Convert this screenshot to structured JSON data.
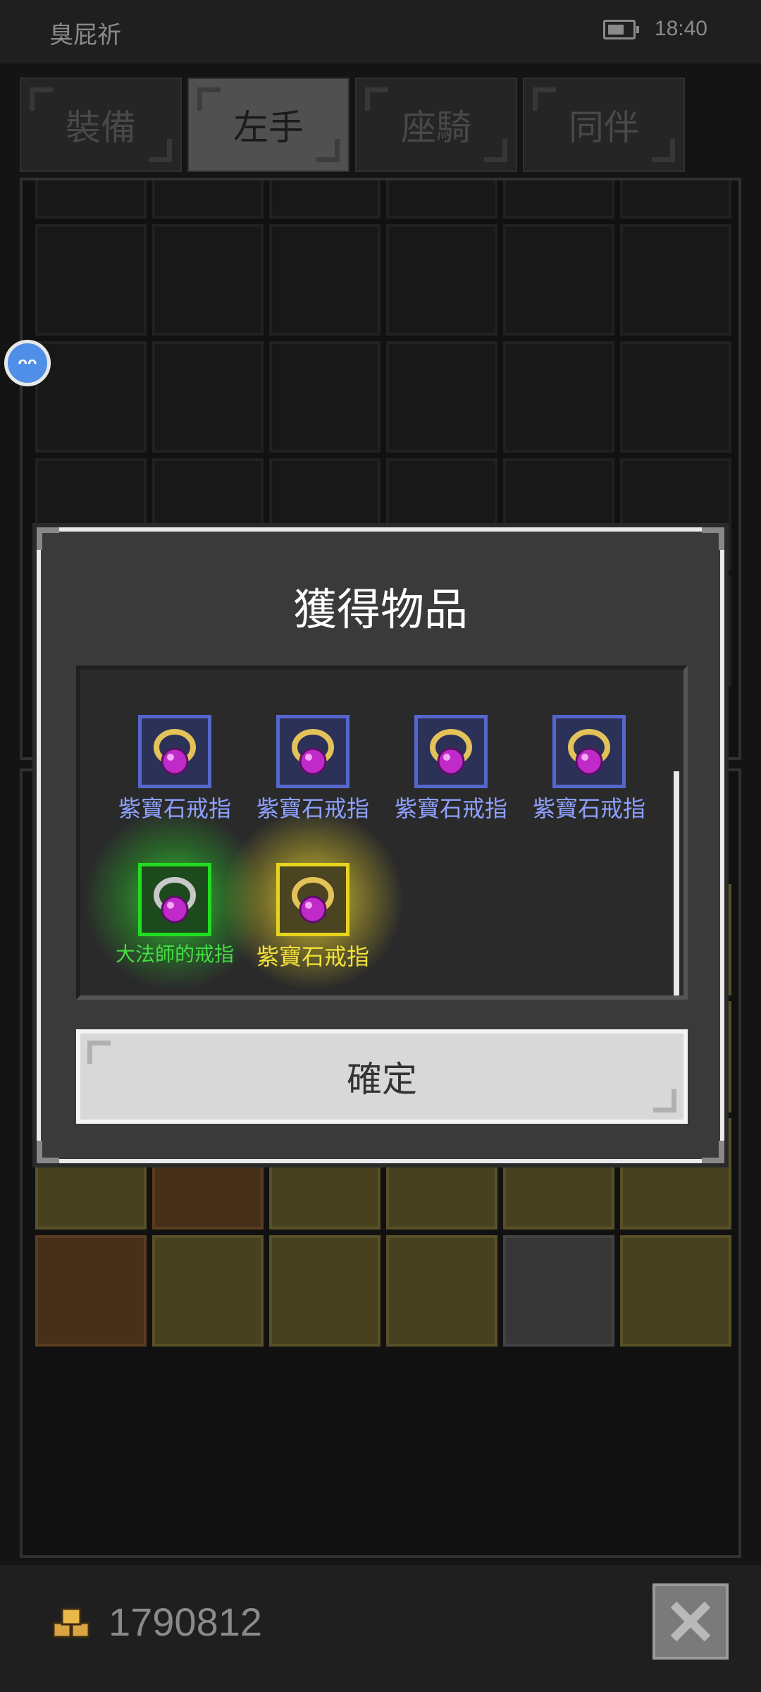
{
  "status_bar": {
    "carrier": "臭屁祈",
    "time": "18:40"
  },
  "tabs": [
    {
      "label": "裝備",
      "active": false
    },
    {
      "label": "左手",
      "active": true
    },
    {
      "label": "座騎",
      "active": false
    },
    {
      "label": "同伴",
      "active": false
    }
  ],
  "dialog": {
    "title": "獲得物品",
    "items": [
      {
        "name": "紫寶石戒指",
        "rarity": "blue",
        "icon": "amethyst-ring-icon"
      },
      {
        "name": "紫寶石戒指",
        "rarity": "blue",
        "icon": "amethyst-ring-icon"
      },
      {
        "name": "紫寶石戒指",
        "rarity": "blue",
        "icon": "amethyst-ring-icon"
      },
      {
        "name": "紫寶石戒指",
        "rarity": "blue",
        "icon": "amethyst-ring-icon"
      },
      {
        "name": "大法師的戒指",
        "rarity": "green",
        "icon": "silver-amethyst-ring-icon"
      },
      {
        "name": "紫寶石戒指",
        "rarity": "yellow",
        "icon": "amethyst-ring-icon"
      }
    ],
    "confirm_label": "確定"
  },
  "bottom": {
    "gold": "1790812"
  },
  "colors": {
    "rare_blue": "#8fa0ff",
    "rare_green": "#44dd44",
    "rare_yellow": "#f2e23a"
  }
}
